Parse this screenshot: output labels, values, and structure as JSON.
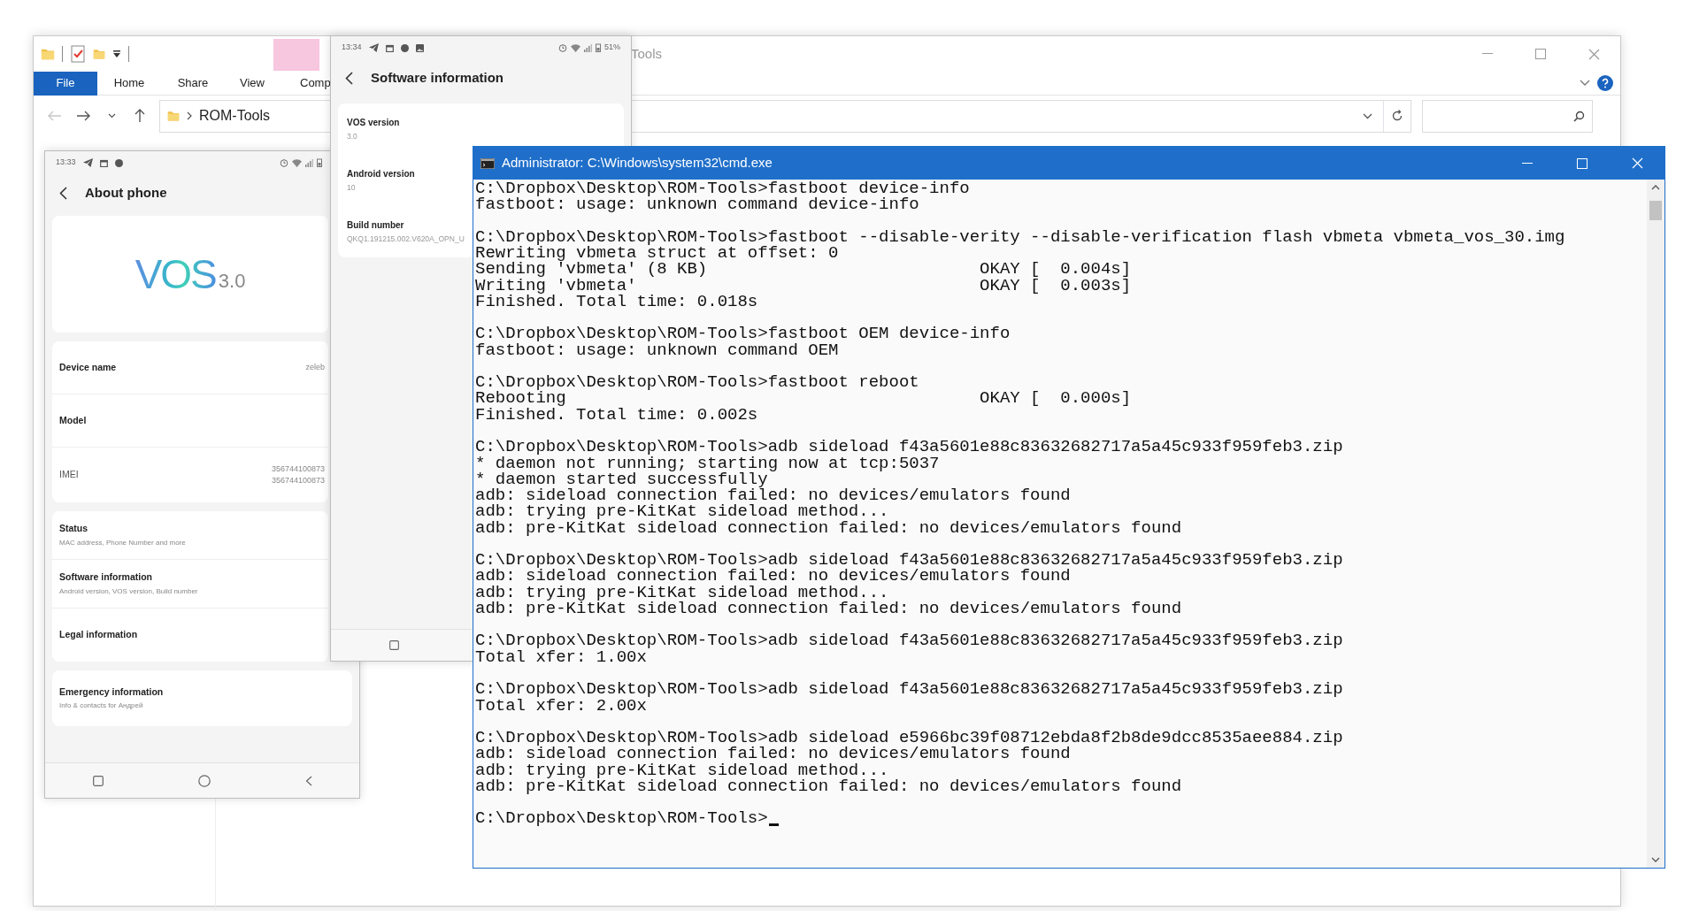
{
  "explorer": {
    "title": "Tools",
    "ribbon_tabs": [
      {
        "label": "File",
        "selected": true
      },
      {
        "label": "Home",
        "selected": false
      },
      {
        "label": "Share",
        "selected": false
      },
      {
        "label": "View",
        "selected": false
      },
      {
        "label": "Comp",
        "selected": false
      }
    ],
    "address": {
      "back_disabled": true,
      "path": "ROM-Tools"
    }
  },
  "phone_about": {
    "time": "13:33",
    "title": "About phone",
    "logo": {
      "name": "VOS",
      "version": "3.0"
    },
    "groups": [
      [
        {
          "kind": "setting",
          "label": "Device name",
          "values": [
            "zeleb"
          ]
        },
        {
          "kind": "setting",
          "label": "Model"
        },
        {
          "kind": "info",
          "label": "IMEI",
          "values": [
            "356744100873",
            "356744100873"
          ]
        }
      ],
      [
        {
          "kind": "setting",
          "label": "Status",
          "subtitle": "MAC address, Phone Number and more"
        },
        {
          "kind": "setting",
          "label": "Software information",
          "subtitle": "Android version, VOS version, Build number"
        },
        {
          "kind": "setting",
          "label": "Legal information"
        }
      ],
      [
        {
          "kind": "setting",
          "label": "Emergency information",
          "subtitle": "Info & contacts for Андрей"
        }
      ]
    ]
  },
  "phone_software": {
    "time": "13:34",
    "battery": "51%",
    "title": "Software information",
    "items": [
      {
        "label": "VOS version",
        "value": "3.0"
      },
      {
        "label": "Android version",
        "value": "10"
      },
      {
        "label": "Build number",
        "value": "QKQ1.191215.002.V620A_OPN_U"
      }
    ]
  },
  "console": {
    "title": "Administrator: C:\\Windows\\system32\\cmd.exe",
    "blocks": [
      [
        "C:\\Dropbox\\Desktop\\ROM-Tools>fastboot device-info",
        "fastboot: usage: unknown command device-info"
      ],
      [
        "C:\\Dropbox\\Desktop\\ROM-Tools>fastboot --disable-verity --disable-verification flash vbmeta vbmeta_vos_30.img",
        "Rewriting vbmeta struct at offset: 0",
        "Sending 'vbmeta' (8 KB)                           OKAY [  0.004s]",
        "Writing 'vbmeta'                                  OKAY [  0.003s]",
        "Finished. Total time: 0.018s"
      ],
      [
        "C:\\Dropbox\\Desktop\\ROM-Tools>fastboot OEM device-info",
        "fastboot: usage: unknown command OEM"
      ],
      [
        "C:\\Dropbox\\Desktop\\ROM-Tools>fastboot reboot",
        "Rebooting                                         OKAY [  0.000s]",
        "Finished. Total time: 0.002s"
      ],
      [
        "C:\\Dropbox\\Desktop\\ROM-Tools>adb sideload f43a5601e88c83632682717a5a45c933f959feb3.zip",
        "* daemon not running; starting now at tcp:5037",
        "* daemon started successfully",
        "adb: sideload connection failed: no devices/emulators found",
        "adb: trying pre-KitKat sideload method...",
        "adb: pre-KitKat sideload connection failed: no devices/emulators found"
      ],
      [
        "C:\\Dropbox\\Desktop\\ROM-Tools>adb sideload f43a5601e88c83632682717a5a45c933f959feb3.zip",
        "adb: sideload connection failed: no devices/emulators found",
        "adb: trying pre-KitKat sideload method...",
        "adb: pre-KitKat sideload connection failed: no devices/emulators found"
      ],
      [
        "C:\\Dropbox\\Desktop\\ROM-Tools>adb sideload f43a5601e88c83632682717a5a45c933f959feb3.zip",
        "Total xfer: 1.00x"
      ],
      [
        "C:\\Dropbox\\Desktop\\ROM-Tools>adb sideload f43a5601e88c83632682717a5a45c933f959feb3.zip",
        "Total xfer: 2.00x"
      ],
      [
        "C:\\Dropbox\\Desktop\\ROM-Tools>adb sideload e5966bc39f08712ebda8f2b8de9dcc8535aee884.zip",
        "adb: sideload connection failed: no devices/emulators found",
        "adb: trying pre-KitKat sideload method...",
        "adb: pre-KitKat sideload connection failed: no devices/emulators found"
      ]
    ],
    "prompt": "C:\\Dropbox\\Desktop\\ROM-Tools>"
  }
}
